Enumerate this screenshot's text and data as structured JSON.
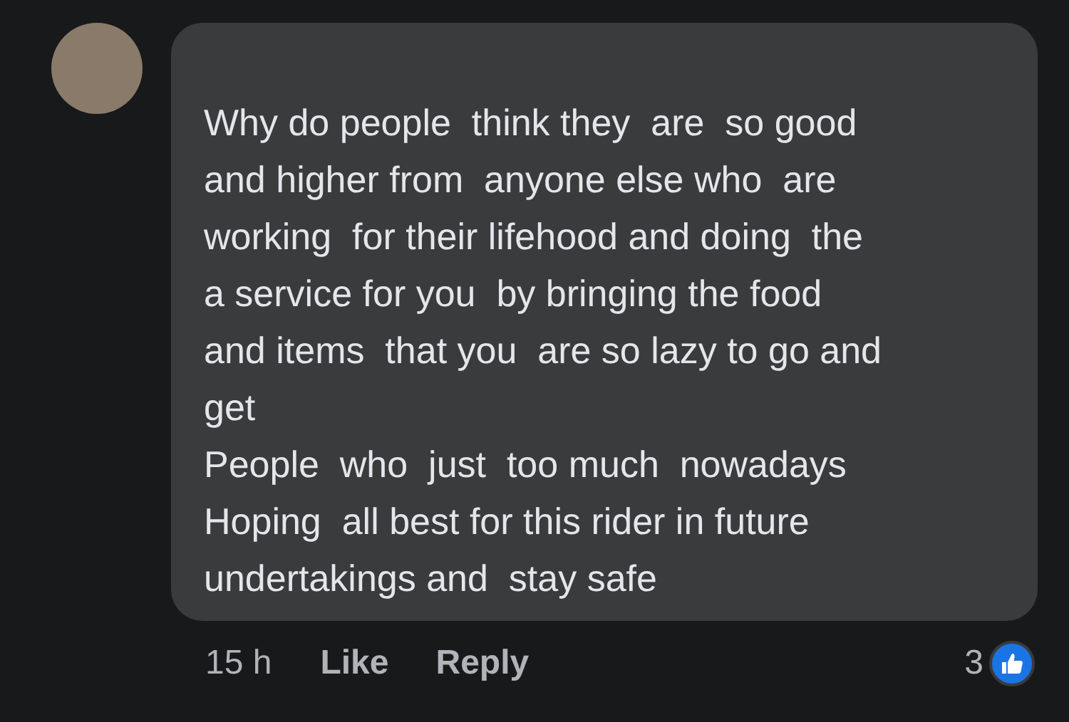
{
  "comment": {
    "text": "Why do people  think they  are  so good\nand higher from  anyone else who  are\nworking  for their lifehood and doing  the\na service for you  by bringing the food\nand items  that you  are so lazy to go and\nget\nPeople  who  just  too much  nowadays\nHoping  all best for this rider in future\nundertakings and  stay safe"
  },
  "actions": {
    "time": "15 h",
    "like": "Like",
    "reply": "Reply",
    "reaction_count": "3"
  }
}
